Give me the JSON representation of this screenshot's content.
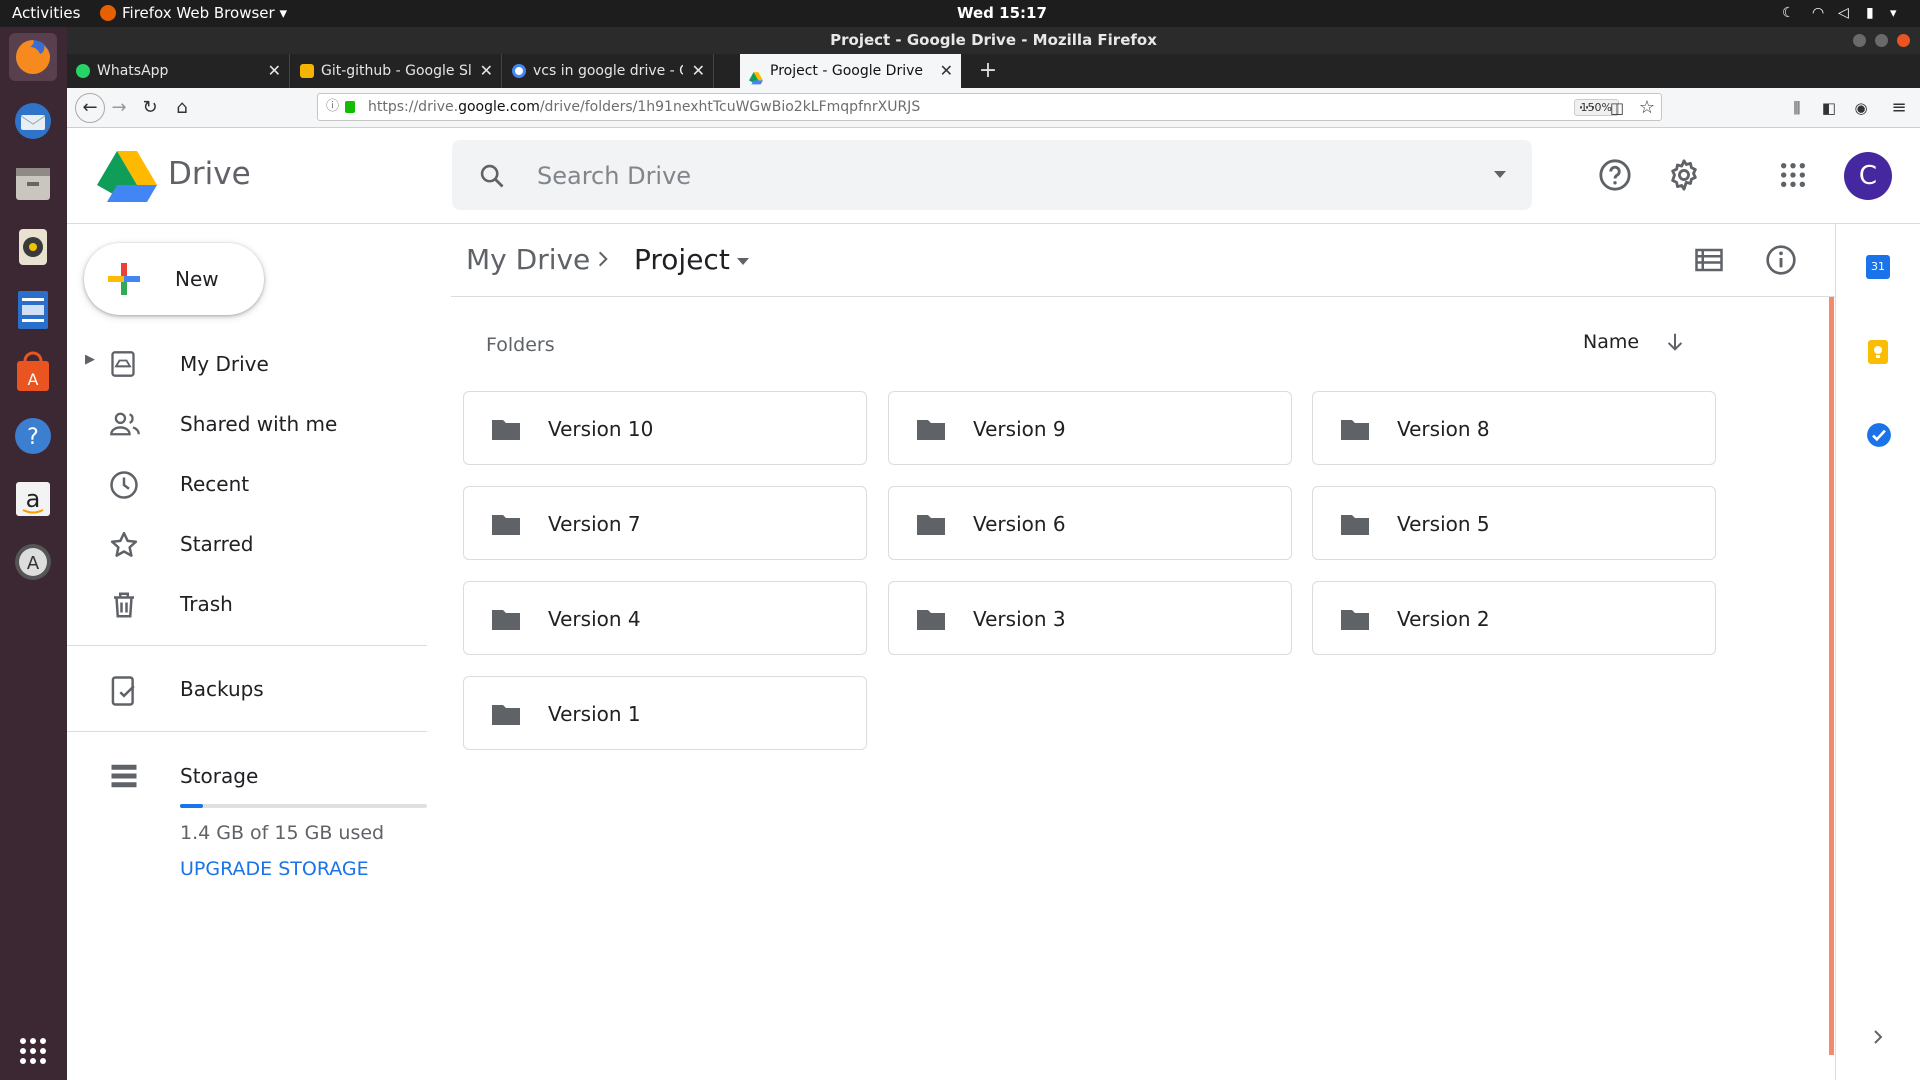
{
  "system": {
    "activities": "Activities",
    "app_menu": "Firefox Web Browser",
    "clock": "Wed 15:17"
  },
  "window": {
    "title": "Project - Google Drive - Mozilla Firefox"
  },
  "tabs": [
    {
      "label": "WhatsApp",
      "icon": "whatsapp-icon",
      "color": "#25d366"
    },
    {
      "label": "Git-github - Google Slides",
      "icon": "google-slides-icon",
      "color": "#f4b400"
    },
    {
      "label": "vcs in google drive - Google Search",
      "icon": "google-icon",
      "color": "#4285f4"
    },
    {
      "label": "Project - Google Drive",
      "icon": "google-drive-icon",
      "color": "#0f9d58"
    }
  ],
  "navbar": {
    "url_prefix": "https://drive.",
    "url_domain": "google.com",
    "url_path": "/drive/folders/1h91nexhtTcuWGwBio2kLFmqpfnrXURJS",
    "zoom": "150%"
  },
  "drive": {
    "logo_text": "Drive",
    "search_placeholder": "Search Drive",
    "avatar_letter": "C",
    "new_label": "New",
    "breadcrumb": {
      "root": "My Drive",
      "current": "Project"
    },
    "section_label": "Folders",
    "sort_label": "Name",
    "folders": [
      "Version 10",
      "Version 9",
      "Version 8",
      "Version 7",
      "Version 6",
      "Version 5",
      "Version 4",
      "Version 3",
      "Version 2",
      "Version 1"
    ]
  },
  "sidebar": {
    "items": [
      {
        "label": "My Drive",
        "icon": "my-drive-icon"
      },
      {
        "label": "Shared with me",
        "icon": "shared-icon"
      },
      {
        "label": "Recent",
        "icon": "clock-icon"
      },
      {
        "label": "Starred",
        "icon": "star-icon"
      },
      {
        "label": "Trash",
        "icon": "trash-icon"
      },
      {
        "label": "Backups",
        "icon": "backups-icon"
      }
    ],
    "storage": {
      "label": "Storage",
      "usage_text": "1.4 GB of 15 GB used",
      "used_fraction": 0.093,
      "upgrade_label": "UPGRADE STORAGE"
    }
  },
  "colors": {
    "accent": "#1a73e8",
    "avatar_bg": "#4527a0",
    "folder_gray": "#5f6368"
  }
}
